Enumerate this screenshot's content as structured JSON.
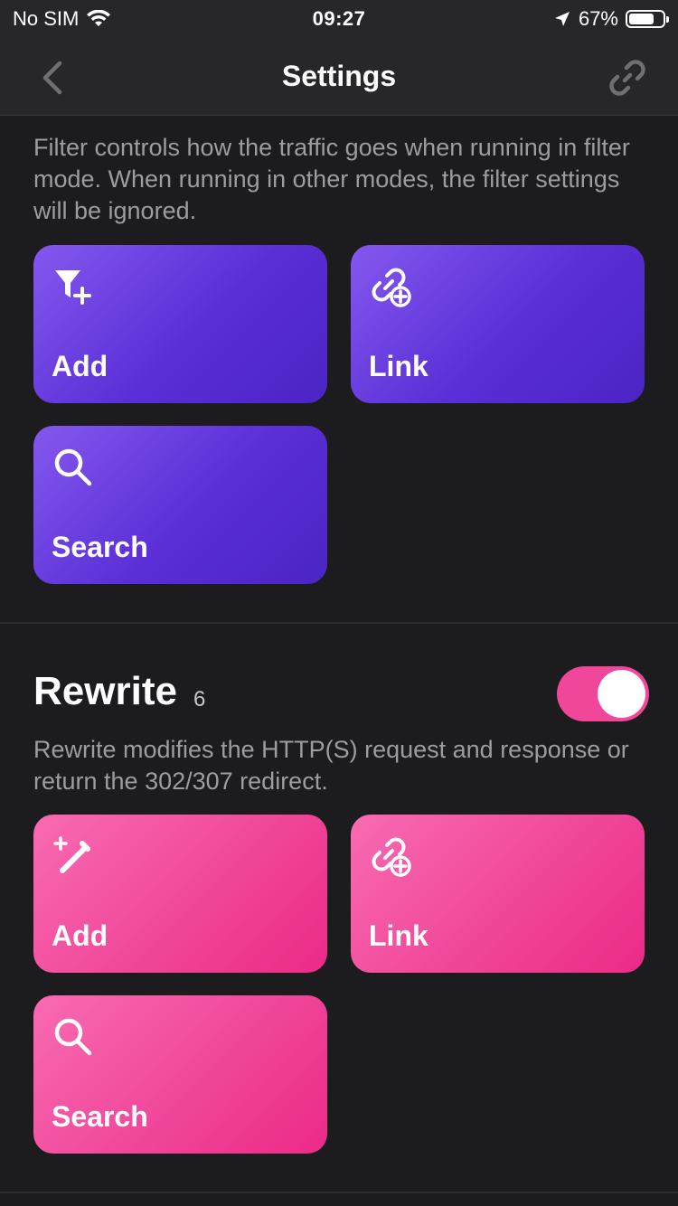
{
  "status_bar": {
    "carrier": "No SIM",
    "time": "09:27",
    "battery": "67%",
    "battery_level": 0.67
  },
  "nav": {
    "title": "Settings"
  },
  "filter": {
    "description": "Filter controls how the traffic goes when running in filter mode. When running in other modes, the filter settings will be ignored.",
    "tiles": {
      "add": "Add",
      "link": "Link",
      "search": "Search"
    },
    "color": "#5a2fd6"
  },
  "rewrite": {
    "title": "Rewrite",
    "count": "6",
    "enabled": true,
    "description": "Rewrite modifies the HTTP(S) request and response or return the 302/307 redirect.",
    "tiles": {
      "add": "Add",
      "link": "Link",
      "search": "Search"
    },
    "color": "#f0479a"
  },
  "icons": [
    "wifi-icon",
    "location-arrow-icon",
    "battery-icon",
    "back-chevron-icon",
    "link-icon",
    "filter-plus-icon",
    "link-plus-icon",
    "search-icon",
    "magic-wand-icon"
  ]
}
